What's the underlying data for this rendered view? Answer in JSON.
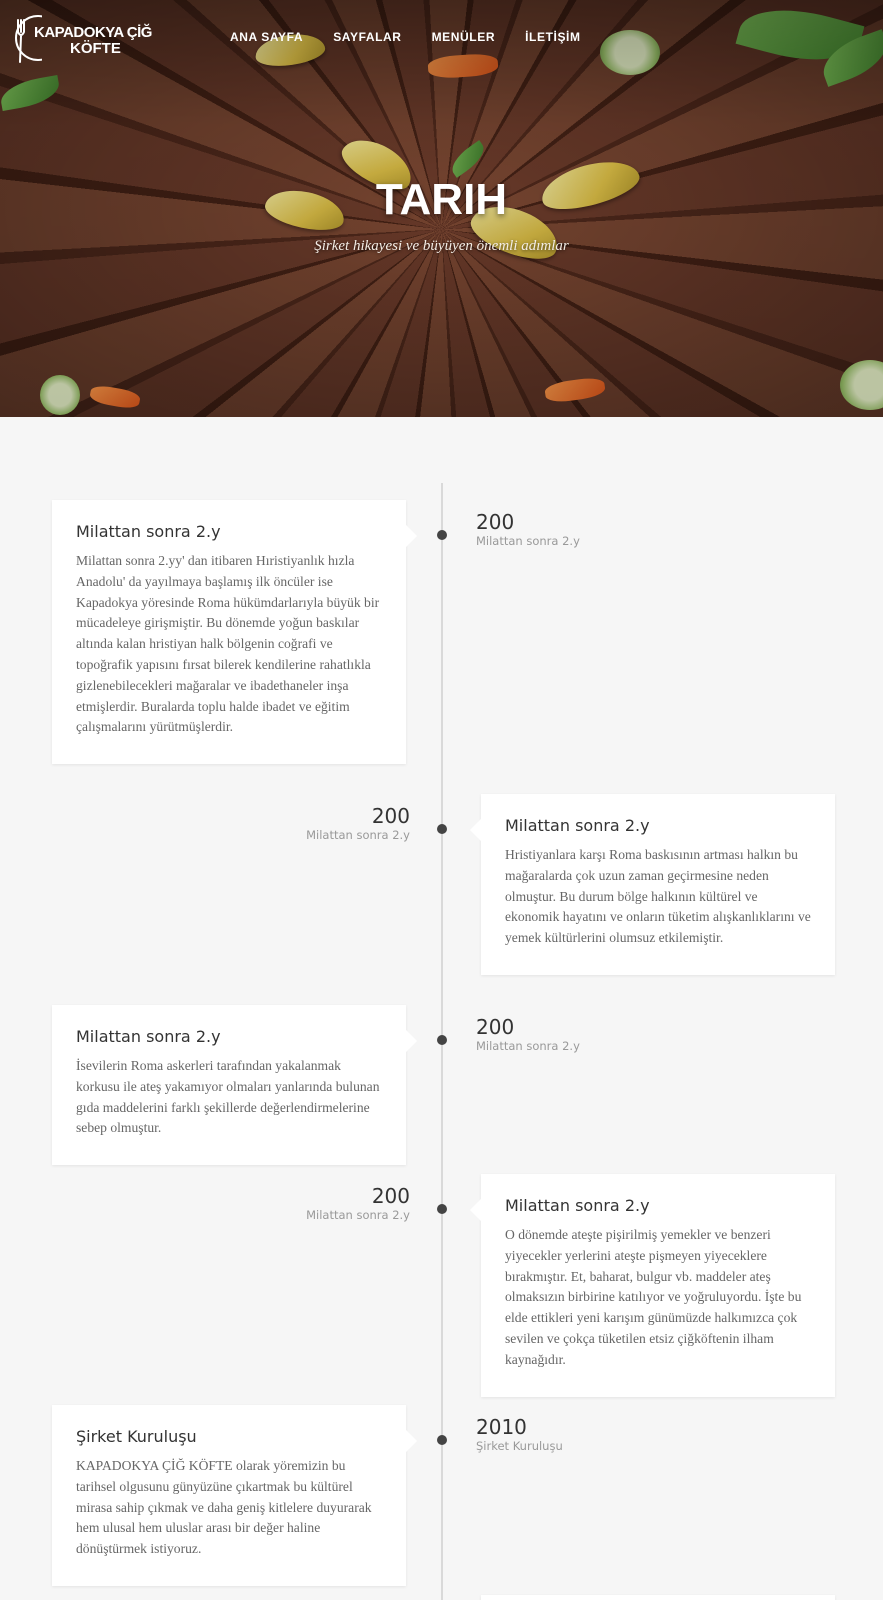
{
  "brand": {
    "line1": "KAPADOKYA ÇİĞ",
    "line2": "KÖFTE"
  },
  "nav": [
    "ANA SAYFA",
    "SAYFALAR",
    "MENÜLER",
    "İLETİŞİM"
  ],
  "hero": {
    "title": "TARIH",
    "subtitle": "Şirket hikayesi ve büyüyen önemli adımlar"
  },
  "timeline": [
    {
      "side": "left",
      "title": "Milattan sonra 2.y",
      "text": "Milattan sonra 2.yy' dan itibaren Hıristiyanlık hızla Anadolu' da yayılmaya başlamış ilk öncüler ise Kapadokya yöresinde Roma hükümdarlarıyla büyük bir mücadeleye girişmiştir. Bu dönemde yoğun baskılar altında kalan hristiyan halk bölgenin coğrafi ve topoğrafik yapısını fırsat bilerek kendilerine rahatlıkla gizlenebilecekleri mağaralar ve ibadethaneler inşa etmişlerdir. Buralarda toplu halde ibadet ve eğitim çalışmalarını yürütmüşlerdir.",
      "year": "200",
      "year_label": "Milattan sonra 2.y"
    },
    {
      "side": "right",
      "title": "Milattan sonra 2.y",
      "text": "Hristiyanlara karşı Roma baskısının artması halkın bu mağaralarda çok uzun zaman geçirmesine neden olmuştur. Bu durum bölge halkının kültürel ve ekonomik hayatını ve onların tüketim alışkanlıklarını ve yemek kültürlerini olumsuz etkilemiştir.",
      "year": "200",
      "year_label": "Milattan sonra 2.y"
    },
    {
      "side": "left",
      "title": "Milattan sonra 2.y",
      "text": "İsevilerin Roma askerleri tarafından yakalanmak korkusu ile ateş yakamıyor olmaları yanlarında bulunan gıda maddelerini farklı şekillerde değerlendirmelerine sebep olmuştur.",
      "year": "200",
      "year_label": "Milattan sonra 2.y"
    },
    {
      "side": "right",
      "title": "Milattan sonra 2.y",
      "text": "O dönemde ateşte pişirilmiş yemekler ve benzeri yiyecekler yerlerini ateşte pişmeyen yiyeceklere bırakmıştır. Et, baharat, bulgur vb. maddeler ateş olmaksızın birbirine katılıyor ve yoğruluyordu. İşte bu elde ettikleri yeni karışım günümüzde halkımızca çok sevilen ve çokça tüketilen etsiz çiğköftenin ilham kaynağıdır.",
      "year": "200",
      "year_label": "Milattan sonra 2.y"
    },
    {
      "side": "left",
      "title": "Şirket Kuruluşu",
      "text": "KAPADOKYA ÇİĞ KÖFTE olarak yöremizin bu tarihsel olgusunu günyüzüne çıkartmak bu kültürel mirasa sahip çıkmak ve daha geniş kitlelere duyurarak hem ulusal hem uluslar arası bir değer haline dönüştürmek istiyoruz.",
      "year": "2010",
      "year_label": "Şirket Kuruluşu"
    }
  ]
}
